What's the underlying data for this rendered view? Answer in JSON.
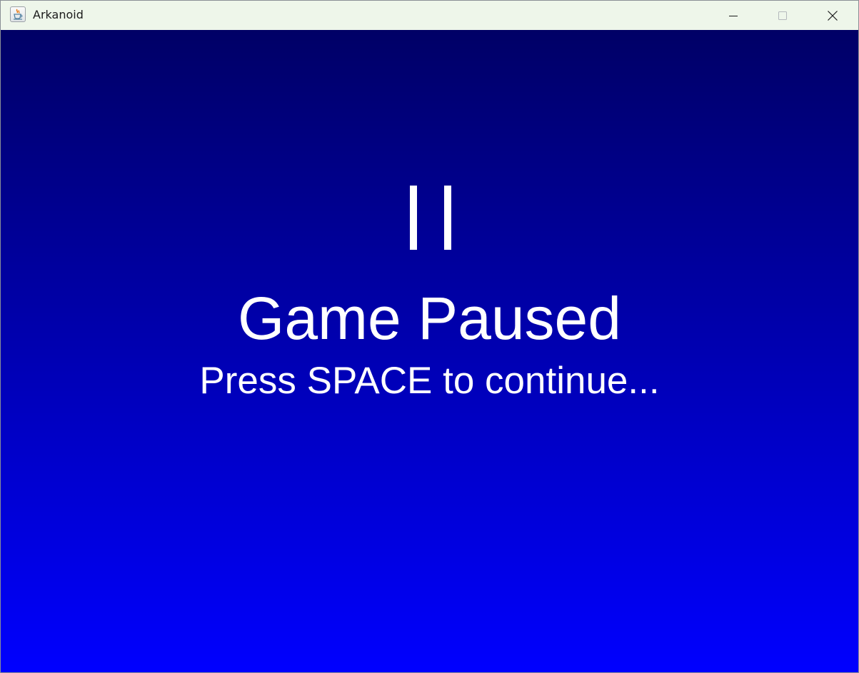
{
  "window": {
    "title": "Arkanoid",
    "icon": "java-app-icon",
    "controls": [
      "minimize-icon",
      "maximize-icon",
      "close-icon"
    ]
  },
  "game": {
    "pause_icon": "pause-icon",
    "headline": "Game Paused",
    "prompt": "Press SPACE to continue...",
    "colors": {
      "background_top": "#000066",
      "background_bottom": "#0000ff",
      "text": "#ffffff"
    }
  }
}
